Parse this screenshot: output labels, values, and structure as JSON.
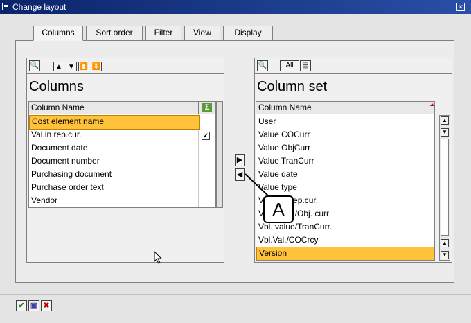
{
  "window": {
    "title": "Change layout",
    "close_icon": "close-icon"
  },
  "tabs": [
    {
      "label": "Columns",
      "active": true
    },
    {
      "label": "Sort order"
    },
    {
      "label": "Filter"
    },
    {
      "label": "View"
    },
    {
      "label": "Display"
    }
  ],
  "left": {
    "title": "Columns",
    "column_header": "Column Name",
    "sum_icon": "Σ",
    "rows": [
      {
        "label": "Cost element name",
        "selected": true
      },
      {
        "label": "Val.in rep.cur.",
        "checked": true
      },
      {
        "label": "Document date"
      },
      {
        "label": "Document number"
      },
      {
        "label": "Purchasing document"
      },
      {
        "label": "Purchase order text"
      },
      {
        "label": "Vendor"
      }
    ]
  },
  "right": {
    "title": "Column set",
    "column_header": "Column Name",
    "all_button": "All",
    "rows": [
      {
        "label": "User"
      },
      {
        "label": "Value COCurr"
      },
      {
        "label": "Value ObjCurr"
      },
      {
        "label": "Value TranCurr"
      },
      {
        "label": "Value date"
      },
      {
        "label": "Value type"
      },
      {
        "label": "Vbl. val./rep.cur."
      },
      {
        "label": "Vbl. value/Obj. curr"
      },
      {
        "label": "Vbl. value/TranCurr."
      },
      {
        "label": "Vbl.Val./COCrcy"
      },
      {
        "label": "Version",
        "selected": true
      }
    ]
  },
  "callout": {
    "label": "A"
  },
  "colors": {
    "selection": "#ffc23a",
    "title_bar": "#0a246a"
  }
}
